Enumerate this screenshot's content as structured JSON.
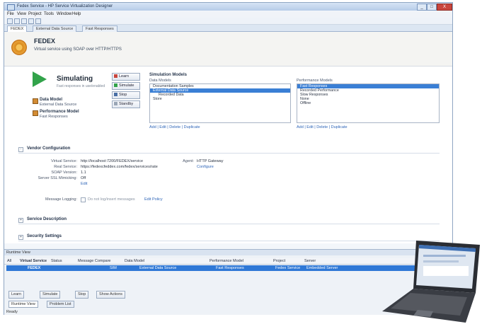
{
  "window": {
    "title": "Fedex Service - HP Service Virtualization Designer",
    "controls": [
      "_",
      "□",
      "X"
    ]
  },
  "menu": [
    "File",
    "View",
    "Project",
    "Tools",
    "Window",
    "Help"
  ],
  "tabs": [
    {
      "label": "FEDEX",
      "active": true
    },
    {
      "label": "External Data Source",
      "active": false
    },
    {
      "label": "Fast Responses",
      "active": false
    }
  ],
  "service": {
    "name": "FEDEX",
    "subtitle": "Virtual service using SOAP over HTTP/HTTPS"
  },
  "simulation": {
    "status": "Simulating",
    "status_sub": "Fast responses in use/enabled",
    "data_model_label": "Data Model",
    "data_model_value": "External Data Source",
    "perf_model_label": "Performance Model",
    "perf_model_value": "Fast Responses",
    "buttons": {
      "learn": "Learn",
      "simulate": "Simulate",
      "stop": "Stop",
      "standby": "Standby"
    }
  },
  "data_models": {
    "title": "Simulation Models",
    "header": "Data Models",
    "items": [
      {
        "label": "Documentation Samples",
        "selected": false
      },
      {
        "label": "External Data Source",
        "selected": true
      },
      {
        "label": "Recorded Data",
        "selected": false
      },
      {
        "label": "Store",
        "selected": false
      }
    ],
    "actions": "Add | Edit | Delete | Duplicate"
  },
  "perf_models": {
    "header": "Performance Models",
    "items": [
      {
        "label": "Fast Responses",
        "selected": true
      },
      {
        "label": "Recorded Performance",
        "selected": false
      },
      {
        "label": "Slow Responses",
        "selected": false
      },
      {
        "label": "None",
        "selected": false
      },
      {
        "label": "Offline",
        "selected": false
      }
    ],
    "actions": "Add | Edit | Delete | Duplicate"
  },
  "vendor_config": {
    "title": "Vendor Configuration",
    "rows": [
      {
        "label": "Virtual Service:",
        "value": "http://localhost:7200/FEDEX/service"
      },
      {
        "label": "Real Service:",
        "value": "https://fedexcfeddex.com/fedex/services/rate"
      },
      {
        "label": "SOAP Version:",
        "value": "1.1"
      },
      {
        "label": "Server SSL Mimicking:",
        "value": "Off"
      }
    ],
    "edit_link": "Edit",
    "agent_label": "Agent:",
    "agent_value": "HTTP Gateway",
    "configure_link": "Configure",
    "logging_label": "Message Logging:",
    "logging_text": "Do not log/insert messages",
    "logging_link": "Edit Policy"
  },
  "sections": {
    "service_description": "Service Description",
    "security_settings": "Security Settings"
  },
  "bottom": {
    "panel_title": "Runtime View",
    "columns": [
      "All",
      "Virtual Service",
      "Status",
      "Message Compare",
      "Data Model",
      "Performance Model",
      "Project",
      "Server"
    ],
    "row": {
      "name": "FEDEX",
      "status": "SIM",
      "data_model": "External Data Source",
      "perf_model": "Fast Responses",
      "project": "Fedex Service",
      "server": "Embedded Server"
    },
    "buttons": [
      "Learn",
      "Simulate",
      "Stop",
      "Show Actions"
    ],
    "tabs": [
      "Runtime View",
      "Problem List"
    ],
    "status_text": "Ready"
  },
  "colors": {
    "accent": "#2f78d6",
    "play": "#32a34a",
    "learn": "#c9463d"
  },
  "icons": {
    "service": "gear-icon",
    "play": "play-icon",
    "device": "laptop-image"
  }
}
